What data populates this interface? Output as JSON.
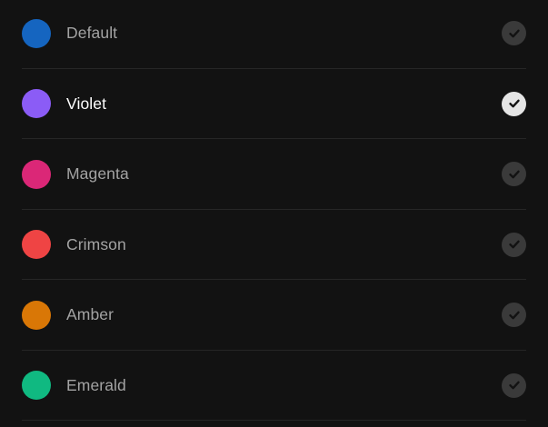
{
  "color_options": [
    {
      "label": "Default",
      "color": "#1565c0",
      "selected": false
    },
    {
      "label": "Violet",
      "color": "#8b5cf6",
      "selected": true
    },
    {
      "label": "Magenta",
      "color": "#db2777",
      "selected": false
    },
    {
      "label": "Crimson",
      "color": "#ef4444",
      "selected": false
    },
    {
      "label": "Amber",
      "color": "#d97706",
      "selected": false
    },
    {
      "label": "Emerald",
      "color": "#10b981",
      "selected": false
    }
  ],
  "icons": {
    "check": "check-icon"
  }
}
